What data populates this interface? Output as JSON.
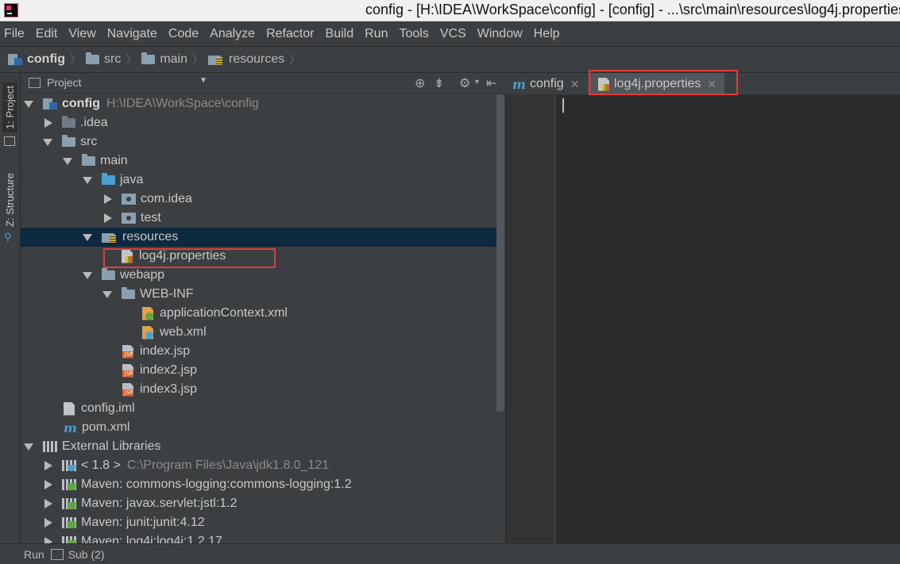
{
  "window": {
    "title": "config - [H:\\IDEA\\WorkSpace\\config] - [config] - ...\\src\\main\\resources\\log4j.properties"
  },
  "menu": [
    "File",
    "Edit",
    "View",
    "Navigate",
    "Code",
    "Analyze",
    "Refactor",
    "Build",
    "Run",
    "Tools",
    "VCS",
    "Window",
    "Help"
  ],
  "breadcrumb": [
    "config",
    "src",
    "main",
    "resources"
  ],
  "left_strip": {
    "project_tab": "1: Project",
    "structure_tab": "Z: Structure"
  },
  "project_panel": {
    "title": "Project",
    "tree": [
      {
        "label": "config",
        "path": "H:\\IDEA\\WorkSpace\\config"
      },
      {
        "label": ".idea"
      },
      {
        "label": "src"
      },
      {
        "label": "main"
      },
      {
        "label": "java"
      },
      {
        "label": "com.idea"
      },
      {
        "label": "test"
      },
      {
        "label": "resources"
      },
      {
        "label": "log4j.properties"
      },
      {
        "label": "webapp"
      },
      {
        "label": "WEB-INF"
      },
      {
        "label": "applicationContext.xml"
      },
      {
        "label": "web.xml"
      },
      {
        "label": "index.jsp"
      },
      {
        "label": "index2.jsp"
      },
      {
        "label": "index3.jsp"
      },
      {
        "label": "config.iml"
      },
      {
        "label": "pom.xml"
      },
      {
        "label": "External Libraries"
      },
      {
        "label": "< 1.8 >",
        "path": "C:\\Program Files\\Java\\jdk1.8.0_121"
      },
      {
        "label": "Maven: commons-logging:commons-logging:1.2"
      },
      {
        "label": "Maven: javax.servlet:jstl:1.2"
      },
      {
        "label": "Maven: junit:junit:4.12"
      },
      {
        "label": "Maven: log4j:log4j:1.2.17"
      }
    ]
  },
  "editor": {
    "tabs": [
      {
        "label": "config",
        "icon": "m"
      },
      {
        "label": "log4j.properties",
        "icon": "properties"
      }
    ]
  },
  "statusbar": {
    "run": "Run",
    "sub": "Sub (2)"
  },
  "colors": {
    "highlight": "#e23b3b",
    "selection": "#0d293e",
    "editor_bg": "#2b2b2b",
    "panel_bg": "#3c3f41"
  }
}
